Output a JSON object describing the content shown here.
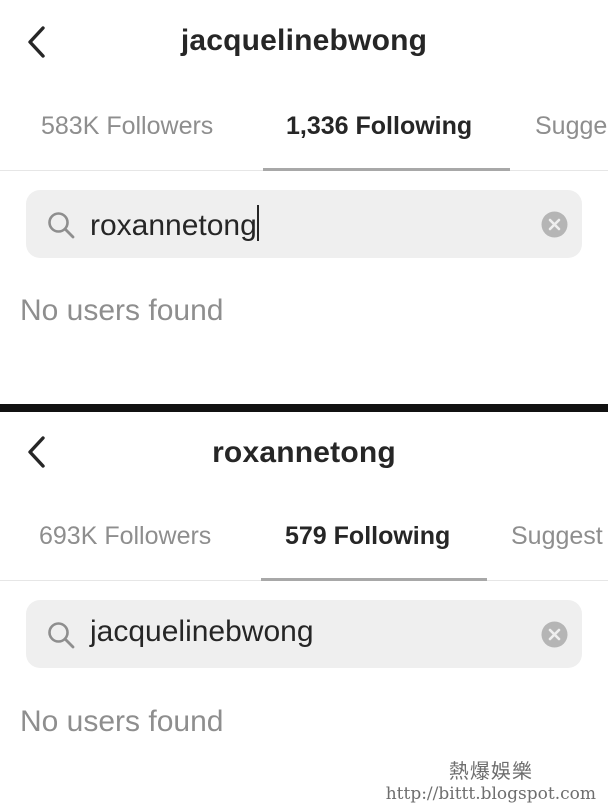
{
  "top": {
    "title": "jacquelinebwong",
    "tabs": [
      {
        "label": "583K Followers",
        "active": false
      },
      {
        "label": "1,336 Following",
        "active": true
      },
      {
        "label": "Sugge",
        "active": false
      }
    ],
    "search": {
      "value": "roxannetong"
    },
    "empty_message": "No users found"
  },
  "bottom": {
    "title": "roxannetong",
    "tabs": [
      {
        "label": "693K Followers",
        "active": false
      },
      {
        "label": "579 Following",
        "active": true
      },
      {
        "label": "Suggest",
        "active": false
      }
    ],
    "search": {
      "value": "jacquelinebwong"
    },
    "empty_message": "No users found"
  },
  "watermark": {
    "chinese": "熱爆娛樂",
    "url": "http://bittt.blogspot.com"
  },
  "icons": [
    "back-chevron-icon",
    "search-icon",
    "clear-icon"
  ],
  "colors": {
    "text": "#262626",
    "muted": "#8e8e8e",
    "search_bg": "#efefef",
    "divider": "#111111"
  }
}
